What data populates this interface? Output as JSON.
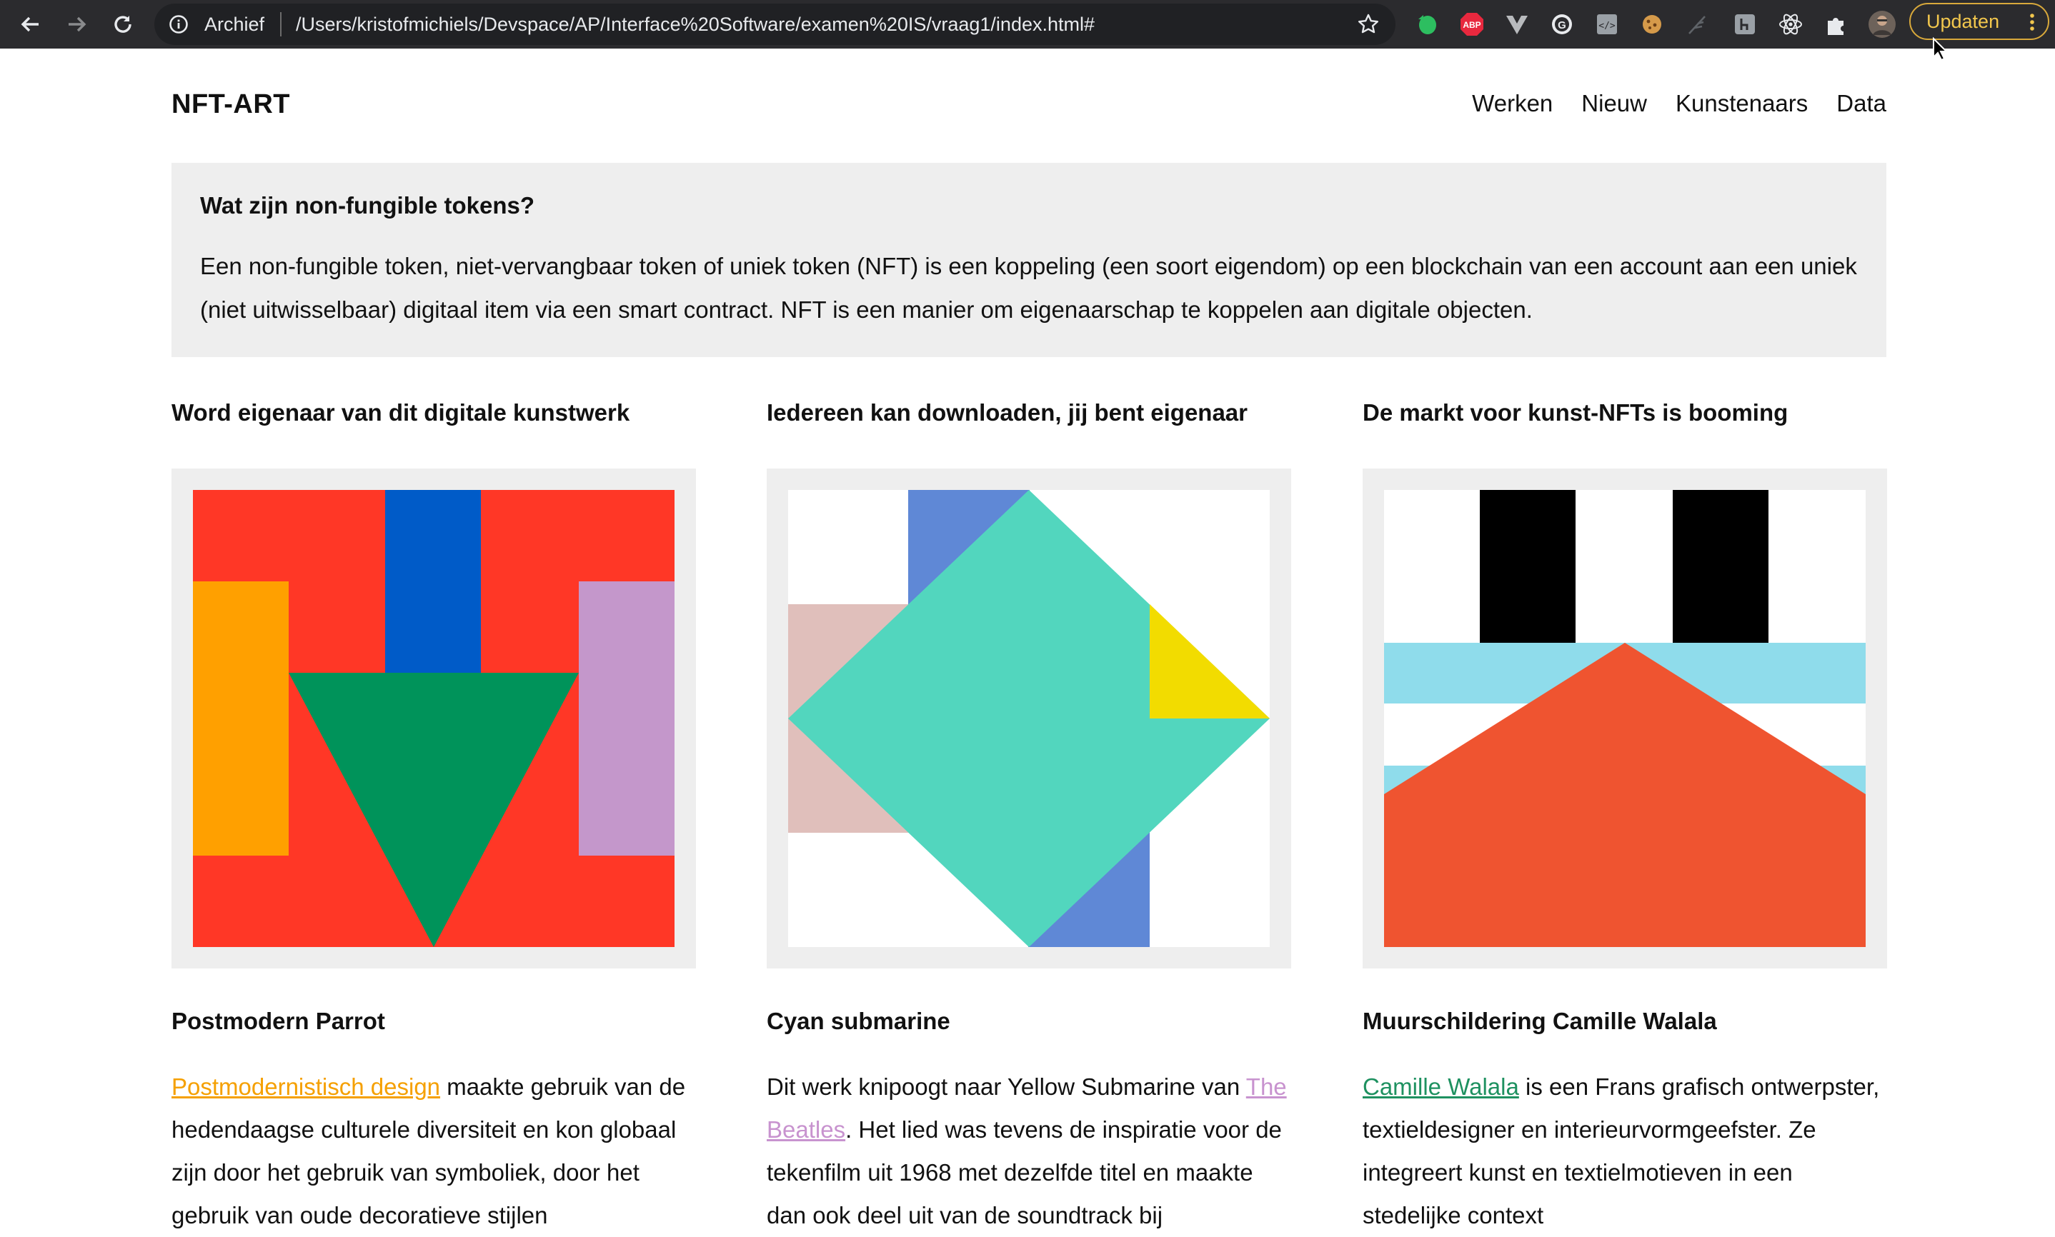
{
  "browser": {
    "location_label": "Archief",
    "url": "/Users/kristofmichiels/Devspace/AP/Interface%20Software/examen%20IS/vraag1/index.html#",
    "update_button": "Updaten",
    "extension_icons": [
      "evernote-icon",
      "adblock-plus-icon",
      "vue-devtools-icon",
      "grammarly-icon",
      "web-developer-icon",
      "cookie-icon",
      "feather-icon",
      "hypothesis-icon",
      "react-devtools-icon",
      "extensions-puzzle-icon",
      "profile-avatar-icon"
    ]
  },
  "site": {
    "title": "NFT-ART",
    "nav": [
      "Werken",
      "Nieuw",
      "Kunstenaars",
      "Data"
    ]
  },
  "intro": {
    "heading": "Wat zijn non-fungible tokens?",
    "text": "Een non-fungible token, niet-vervangbaar token of uniek token (NFT) is een koppeling (een soort eigendom) op een blockchain van een account aan een uniek (niet uitwisselbaar) digitaal item via een smart contract. NFT is een manier om eigenaarschap te koppelen aan digitale objecten."
  },
  "columns": [
    {
      "heading": "Word eigenaar van dit digitale kunstwerk",
      "artwork_title": "Postmodern Parrot",
      "link_text": "Postmodernistisch design",
      "text": " maakte gebruik van de hedendaagse culturele diversiteit en kon globaal zijn door het gebruik van symboliek, door het gebruik van oude decoratieve stijlen"
    },
    {
      "heading": "Iedereen kan downloaden, jij bent eigenaar",
      "artwork_title": "Cyan submarine",
      "text_before": "Dit werk knipoogt naar Yellow Submarine van ",
      "link_text": "The Beatles",
      "text": ". Het lied was tevens de inspiratie voor de tekenfilm uit 1968 met dezelfde titel en maakte dan ook deel uit van de soundtrack bij"
    },
    {
      "heading": "De markt voor kunst-NFTs is booming",
      "artwork_title": "Muurschildering Camille Walala",
      "link_text": "Camille Walala",
      "text": " is een Frans grafisch ontwerpster, textieldesigner en interieurvormgeefster. Ze integreert kunst en textielmotieven in een stedelijke context"
    }
  ],
  "colors": {
    "red": "#ff3726",
    "blue": "#005bc8",
    "orange": "#ffa000",
    "green": "#00935a",
    "lilac": "#c497cb",
    "periwinkle": "#5f88d6",
    "cyan": "#52d6be",
    "pink": "#e0bfbb",
    "yellow": "#f2dc00",
    "light-blue": "#8fdceb",
    "vermilion": "#ef5430",
    "black": "#000000"
  }
}
